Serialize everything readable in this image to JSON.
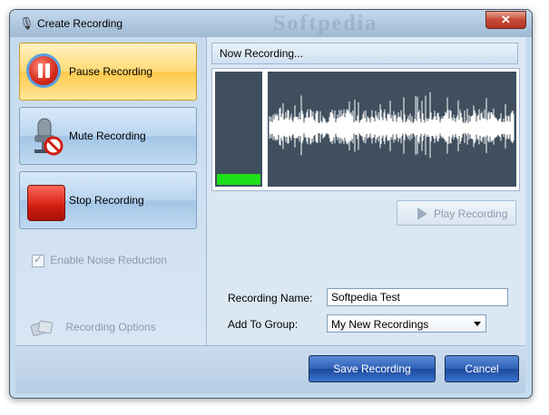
{
  "window": {
    "title": "Create Recording",
    "watermark": "Softpedia",
    "close_label": "✕"
  },
  "left_panel": {
    "pause_label": "Pause Recording",
    "mute_label": "Mute Recording",
    "stop_label": "Stop Recording",
    "noise_reduction_label": "Enable Noise Reduction",
    "noise_reduction_checked": true,
    "options_label": "Recording Options"
  },
  "recording": {
    "header": "Now Recording...",
    "level_fraction": 0.1,
    "play_label": "Play Recording"
  },
  "form": {
    "name_label": "Recording Name:",
    "name_value": "Softpedia Test",
    "group_label": "Add To Group:",
    "group_value": "My New Recordings"
  },
  "footer": {
    "save_label": "Save Recording",
    "cancel_label": "Cancel"
  },
  "colors": {
    "level_meter": "#1ee01a",
    "viz_bg": "#3f4f5e",
    "accent": "#2e61b8"
  },
  "icons": {
    "title": "microphone-icon",
    "pause": "pause-icon",
    "mute": "microphone-mute-icon",
    "stop": "stop-icon",
    "options": "options-icon",
    "play": "play-icon",
    "dropdown": "chevron-down-icon"
  }
}
